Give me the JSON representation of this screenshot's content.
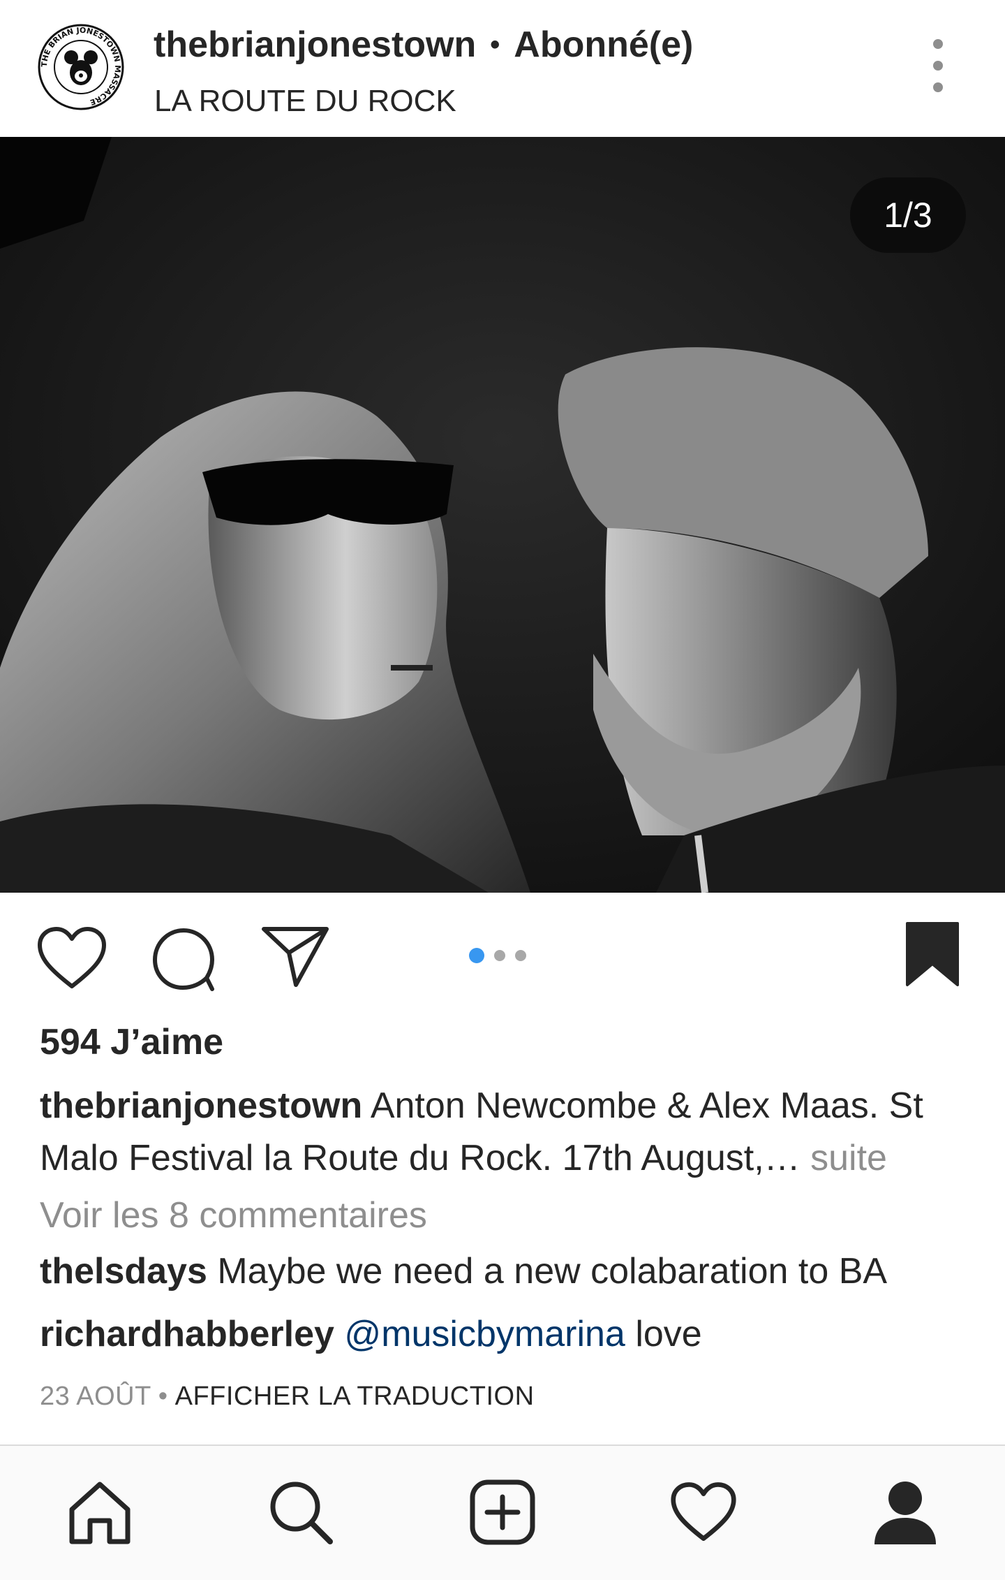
{
  "header": {
    "username": "thebrianjonestown",
    "separator": "•",
    "follow_status": "Abonné(e)",
    "location": "LA ROUTE DU ROCK",
    "avatar_text": "THE BRIAN JONESTOWN MASSACRE"
  },
  "post": {
    "carousel_counter": "1/3",
    "carousel_current": 1,
    "carousel_total": 3,
    "likes": "594 J’aime",
    "caption_user": "thebrianjonestown",
    "caption_text": "Anton Newcombe & Alex Maas. St Malo Festival la Route du Rock. 17th August,…",
    "caption_more": "suite",
    "view_comments": "Voir les 8 commentaires",
    "comments": [
      {
        "user": "thelsdays",
        "text": "Maybe we need a new colabaration to BA"
      },
      {
        "user": "richardhabberley",
        "mention": "@musicbymarina",
        "text": "love"
      }
    ],
    "date": "23 AOÛT",
    "meta_separator": "•",
    "translate": "AFFICHER LA TRADUCTION"
  },
  "icons": {
    "like": "heart-icon",
    "comment": "comment-bubble-icon",
    "share": "paper-plane-icon",
    "save": "bookmark-filled-icon",
    "more": "more-vertical-icon"
  },
  "nav": [
    "home-icon",
    "search-icon",
    "new-post-icon",
    "activity-heart-icon",
    "profile-icon"
  ],
  "colors": {
    "text": "#262626",
    "muted": "#8e8e8e",
    "link": "#003569",
    "carousel_active": "#3897f0"
  }
}
